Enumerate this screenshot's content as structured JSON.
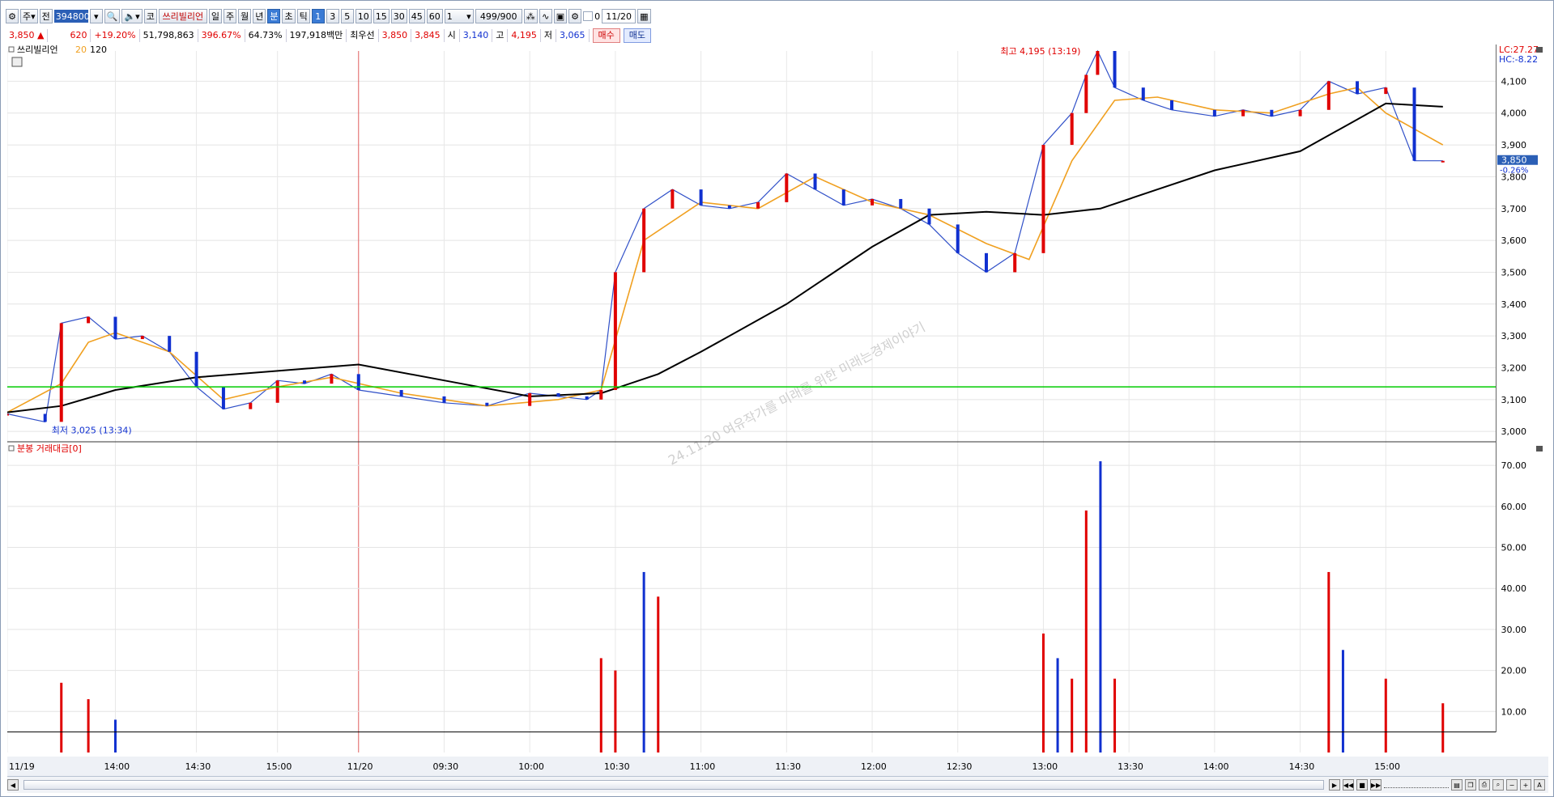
{
  "toolbar": {
    "period_selected": "주",
    "jeon_label": "전",
    "stock_code": "394800",
    "market_label": "코",
    "stock_name": "쓰리빌리언",
    "period_buttons": [
      "일",
      "주",
      "월",
      "년",
      "분",
      "초",
      "틱"
    ],
    "interval_buttons": [
      "1",
      "3",
      "5",
      "10",
      "15",
      "30",
      "45",
      "60"
    ],
    "multiplier": "1",
    "count": "499/900",
    "checkbox_label": "0",
    "date": "11/20"
  },
  "quote": {
    "price": "3,850",
    "change": "620",
    "change_pct": "+19.20%",
    "volume": "51,798,863",
    "vol_ratio": "396.67%",
    "rate": "64.73%",
    "amount": "197,918백만",
    "best_bid_label": "최우선",
    "best_bid": "3,850",
    "best_ask": "3,845",
    "open_label": "시",
    "open": "3,140",
    "high_label": "고",
    "high": "4,195",
    "low_label": "저",
    "low": "3,065",
    "buy_label": "매수",
    "sell_label": "매도"
  },
  "price_panel": {
    "legend_name": "쓰리빌리언",
    "ma_short": "20",
    "ma_long": "120",
    "lc_label": "LC:27.27",
    "hc_label": "HC:-8.22",
    "high_annotation": "최고 4,195 (13:19)",
    "low_annotation": "최저 3,025 (13:34)",
    "current_price_tag": "3,850",
    "current_change_tag": "-0.26%",
    "watermark": "24.11.20 여유작가를 미래를 위한 미래는경제이야기",
    "colors": {
      "up": "#e00000",
      "down": "#1030d0",
      "ma20": "#f0a020",
      "ma120": "#000000",
      "support": "#00cc00"
    }
  },
  "volume_panel": {
    "legend": "분봉 거래대금[0]"
  },
  "chart_data": [
    {
      "type": "line",
      "title": "",
      "x_tick_labels": [
        "11/19",
        "14:00",
        "14:30",
        "15:00",
        "11/20",
        "09:30",
        "10:00",
        "10:30",
        "11:00",
        "11:30",
        "12:00",
        "12:30",
        "13:00",
        "13:30",
        "14:00",
        "14:30",
        "15:00"
      ],
      "y_ticks": [
        3000,
        3100,
        3200,
        3300,
        3400,
        3500,
        3600,
        3700,
        3800,
        3900,
        4000,
        4100
      ],
      "ylim": [
        2975,
        4195
      ],
      "support_line": 3140,
      "series": [
        {
          "name": "쓰리빌리언",
          "x": [
            "11/19 13:20",
            "13:34",
            "13:40",
            "13:50",
            "14:00",
            "14:10",
            "14:20",
            "14:30",
            "14:40",
            "14:50",
            "15:00",
            "15:10",
            "15:20",
            "11/20 09:00",
            "09:15",
            "09:30",
            "09:45",
            "10:00",
            "10:10",
            "10:20",
            "10:25",
            "10:30",
            "10:40",
            "10:50",
            "11:00",
            "11:10",
            "11:20",
            "11:30",
            "11:40",
            "11:50",
            "12:00",
            "12:10",
            "12:20",
            "12:30",
            "12:40",
            "12:50",
            "13:00",
            "13:10",
            "13:15",
            "13:19",
            "13:25",
            "13:35",
            "13:45",
            "14:00",
            "14:10",
            "14:20",
            "14:30",
            "14:40",
            "14:50",
            "15:00",
            "15:10",
            "15:20"
          ],
          "values": [
            3055,
            3030,
            3340,
            3360,
            3290,
            3300,
            3250,
            3140,
            3070,
            3090,
            3160,
            3150,
            3180,
            3130,
            3110,
            3090,
            3080,
            3120,
            3110,
            3100,
            3130,
            3500,
            3700,
            3760,
            3710,
            3700,
            3720,
            3810,
            3760,
            3710,
            3730,
            3700,
            3650,
            3560,
            3500,
            3560,
            3900,
            4000,
            4120,
            4195,
            4080,
            4040,
            4010,
            3990,
            4010,
            3990,
            4010,
            4100,
            4060,
            4080,
            3850,
            3850
          ]
        },
        {
          "name": "20",
          "x": [
            "11/19 13:20",
            "13:40",
            "13:50",
            "14:00",
            "14:20",
            "14:40",
            "15:00",
            "15:20",
            "11/20 09:15",
            "09:45",
            "10:10",
            "10:25",
            "10:40",
            "11:00",
            "11:20",
            "11:40",
            "12:00",
            "12:20",
            "12:40",
            "12:55",
            "13:10",
            "13:25",
            "13:40",
            "14:00",
            "14:20",
            "14:40",
            "14:50",
            "15:00",
            "15:20"
          ],
          "values": [
            3060,
            3150,
            3280,
            3310,
            3250,
            3100,
            3140,
            3170,
            3120,
            3080,
            3100,
            3130,
            3600,
            3720,
            3700,
            3800,
            3720,
            3680,
            3590,
            3540,
            3850,
            4040,
            4050,
            4010,
            4000,
            4060,
            4080,
            4000,
            3900
          ]
        },
        {
          "name": "120",
          "x": [
            "11/19 13:20",
            "13:40",
            "14:00",
            "14:30",
            "15:00",
            "11/20 09:00",
            "09:30",
            "10:00",
            "10:25",
            "10:45",
            "11:00",
            "11:30",
            "12:00",
            "12:20",
            "12:40",
            "13:00",
            "13:20",
            "13:40",
            "14:00",
            "14:30",
            "14:50",
            "15:00",
            "15:20"
          ],
          "values": [
            3060,
            3080,
            3130,
            3170,
            3190,
            3210,
            3160,
            3110,
            3120,
            3180,
            3250,
            3400,
            3580,
            3680,
            3690,
            3680,
            3700,
            3760,
            3820,
            3880,
            3980,
            4030,
            4020
          ]
        }
      ]
    },
    {
      "type": "bar",
      "title": "",
      "y_ticks": [
        10,
        20,
        30,
        40,
        50,
        60,
        70
      ],
      "ylim": [
        0,
        72
      ],
      "reference_line": 5,
      "x": [
        "11/19 13:40",
        "13:50",
        "14:00",
        "11/20 10:25",
        "10:30",
        "10:40",
        "10:45",
        "13:00",
        "13:05",
        "13:10",
        "13:15",
        "13:20",
        "13:25",
        "14:40",
        "14:45",
        "15:00",
        "15:20"
      ],
      "values": [
        17,
        13,
        8,
        23,
        20,
        44,
        38,
        29,
        23,
        18,
        59,
        71,
        18,
        44,
        25,
        18,
        12
      ]
    }
  ]
}
